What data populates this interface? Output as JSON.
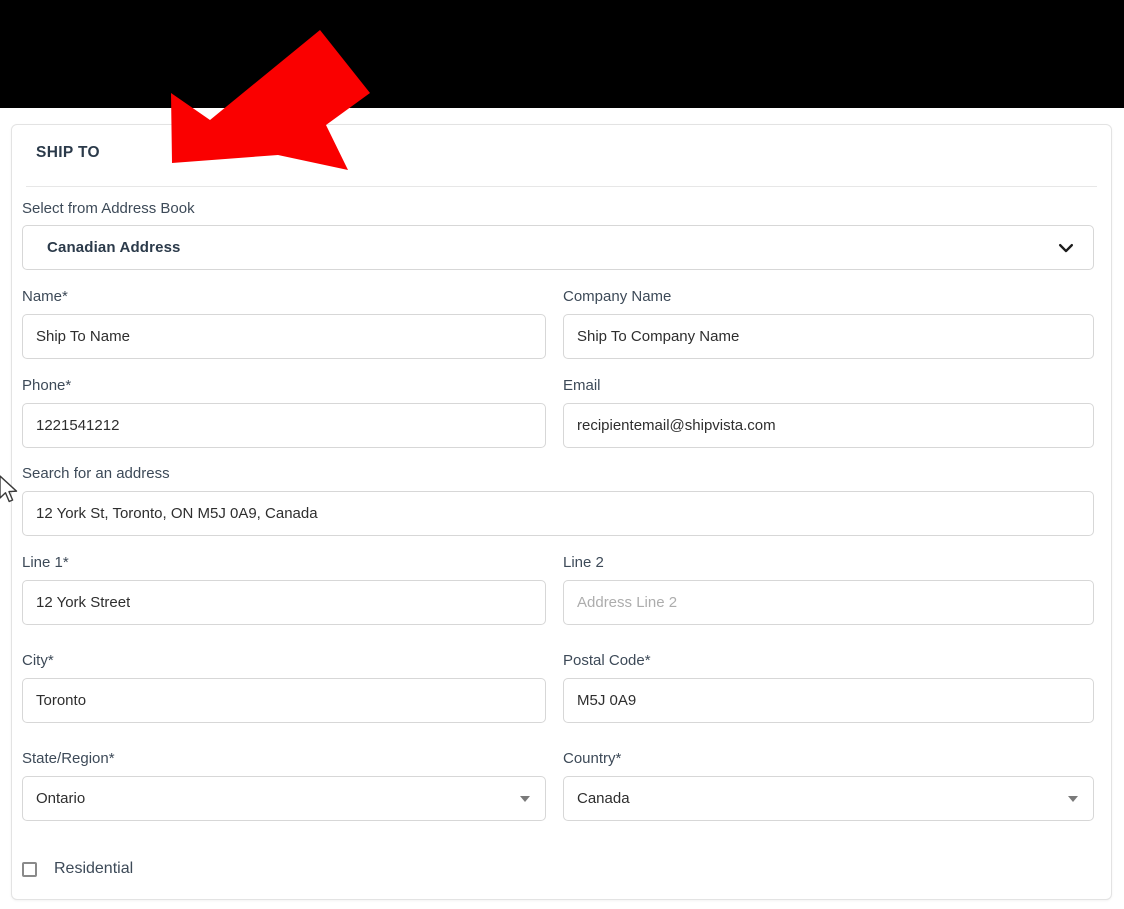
{
  "section": {
    "title": "SHIP TO"
  },
  "address_book": {
    "label": "Select from Address Book",
    "selected": "Canadian Address",
    "chevron_icon": "chevron-down-icon"
  },
  "fields": {
    "name": {
      "label": "Name*",
      "value": "Ship To Name"
    },
    "company_name": {
      "label": "Company Name",
      "value": "Ship To Company Name"
    },
    "phone": {
      "label": "Phone*",
      "value": "1221541212"
    },
    "email": {
      "label": "Email",
      "value": "recipientemail@shipvista.com"
    },
    "address_search": {
      "label": "Search for an address",
      "value": "12 York St, Toronto, ON M5J 0A9, Canada"
    },
    "line1": {
      "label": "Line 1*",
      "value": "12 York Street"
    },
    "line2": {
      "label": "Line 2",
      "value": "",
      "placeholder": "Address Line 2"
    },
    "city": {
      "label": "City*",
      "value": "Toronto"
    },
    "postal_code": {
      "label": "Postal Code*",
      "value": "M5J 0A9"
    },
    "state_region": {
      "label": "State/Region*",
      "selected": "Ontario",
      "caret_icon": "triangle-down-icon"
    },
    "country": {
      "label": "Country*",
      "selected": "Canada",
      "caret_icon": "triangle-down-icon"
    }
  },
  "residential": {
    "label": "Residential",
    "checked": false
  },
  "annotation": {
    "arrow_icon": "red-arrow-pointing-down-left",
    "color": "#fa0000"
  },
  "cursor": {
    "icon": "mouse-pointer-icon"
  },
  "colors": {
    "topbar": "#000000",
    "card_border": "#e3e3e3",
    "label_text": "#3d4a58",
    "value_text": "#2e2e2e",
    "placeholder_text": "#adadad",
    "title_text": "#2b3a4a",
    "input_border": "#d7d7d7",
    "annotation_red": "#fa0000"
  }
}
